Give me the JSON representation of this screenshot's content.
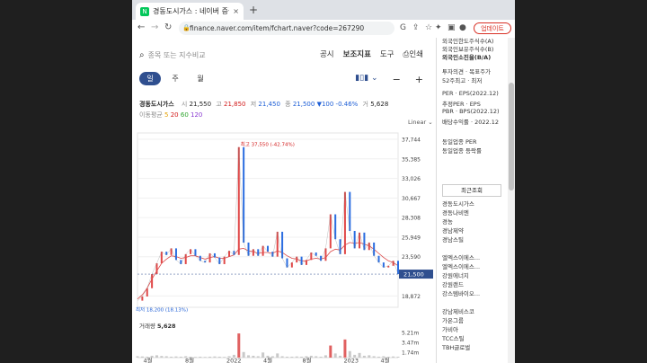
{
  "tab": {
    "title": "경동도시가스 : 네이버 증권",
    "close": "×",
    "new": "+",
    "favicon": "N"
  },
  "address": {
    "url": "finance.naver.com/item/fchart.naver?code=267290",
    "update_label": "업데이트"
  },
  "search": {
    "placeholder": "종목 또는 지수비교"
  },
  "menu": {
    "items": [
      "공시",
      "보조지표",
      "도구",
      "인쇄"
    ]
  },
  "periods": [
    "일",
    "주",
    "월"
  ],
  "stock": {
    "name": "경동도시가스",
    "open_label": "시",
    "open": "21,550",
    "high_label": "고",
    "high": "21,850",
    "low_label": "저",
    "low": "21,450",
    "close_label": "종",
    "close": "21,500",
    "change": "▼100",
    "change_pct": "-0.46%",
    "volume_label": "거",
    "volume": "5,628"
  },
  "ma": {
    "label": "이동평균",
    "values": [
      "5",
      "20",
      "60",
      "120"
    ],
    "colors": [
      "#e5a000",
      "#d21b1b",
      "#2fa52f",
      "#8a3ad1"
    ]
  },
  "scale_label": "Linear",
  "chart_data": {
    "type": "line",
    "price_ticks": [
      "37,744",
      "35,385",
      "33,026",
      "30,667",
      "28,308",
      "25,949",
      "23,590",
      "21,500",
      "18,872"
    ],
    "x_labels": [
      "4월",
      "8월",
      "2022",
      "4월",
      "8월",
      "2023",
      "4월"
    ],
    "max_label": "최고 37,550 (-42.74%)",
    "min_label": "최저 18,200 (18.13%)",
    "current_price": "21,500",
    "volume_title": "거래량",
    "volume_value": "5,628",
    "volume_ticks": [
      "5.21m",
      "3.47m",
      "1.74m"
    ],
    "prices": [
      18300,
      18800,
      19800,
      21500,
      22800,
      24200,
      23800,
      24600,
      23200,
      22700,
      23900,
      24500,
      23700,
      23100,
      22900,
      24000,
      23500,
      22700,
      23600,
      24300,
      23800,
      36800,
      25300,
      23700,
      24500,
      23700,
      24900,
      24200,
      23600,
      26600,
      23400,
      22300,
      22900,
      23600,
      22600,
      23200,
      24100,
      23700,
      23100,
      24600,
      28700,
      25700,
      23900,
      31400,
      26700,
      24600,
      26500,
      24400,
      25300,
      23700,
      22900,
      22300,
      22500,
      23100,
      21500
    ],
    "ma20": [
      18500,
      19000,
      19800,
      20900,
      21900,
      22800,
      23300,
      23700,
      23600,
      23400,
      23500,
      23700,
      23700,
      23500,
      23300,
      23500,
      23600,
      23400,
      23400,
      23600,
      23800,
      24500,
      24600,
      24300,
      24200,
      24000,
      24100,
      24100,
      24000,
      24300,
      24100,
      23700,
      23400,
      23300,
      23100,
      23100,
      23300,
      23400,
      23300,
      23500,
      24200,
      24500,
      24400,
      25000,
      25300,
      25200,
      25300,
      25100,
      24900,
      24500,
      24000,
      23500,
      23100,
      22900,
      22500
    ],
    "volumes": [
      0.3,
      0.25,
      0.2,
      0.4,
      0.5,
      0.35,
      0.3,
      0.2,
      0.25,
      0.2,
      0.3,
      0.2,
      0.15,
      0.2,
      0.15,
      0.2,
      0.25,
      0.2,
      0.15,
      0.3,
      0.6,
      5.2,
      1.2,
      0.5,
      0.4,
      0.3,
      1.1,
      0.4,
      0.3,
      0.9,
      0.3,
      0.2,
      0.2,
      0.25,
      0.2,
      0.3,
      0.4,
      0.3,
      0.2,
      0.5,
      2.6,
      0.9,
      0.4,
      3.9,
      1.4,
      0.6,
      1.0,
      0.4,
      0.5,
      0.3,
      0.2,
      0.3,
      0.2,
      0.25,
      0.2
    ],
    "ylim": [
      17500,
      38500
    ],
    "volume_max": 5.8
  },
  "right_panel": {
    "top": [
      "외국인한도주식수(A)",
      "외국인보유주식수(B)",
      "외국인소진율(B/A)"
    ],
    "opinion": [
      "투자의견 · 목표주가",
      "52주최고 · 최저"
    ],
    "per": [
      "PER · EPS(2022.12)",
      "추정PER · EPS",
      "PBR · BPS(2022.12)",
      "배당수익률 · 2022.12"
    ],
    "industry": [
      "동일업종 PER",
      "동일업종 등락률"
    ],
    "recent_header": "최근조회",
    "recent": [
      "경동도시가스",
      "경동나비엔",
      "경농",
      "경남제약",
      "경남스틸",
      "",
      "엘엑스이에스...",
      "엘엑스이에스...",
      "강원에너지",
      "강원랜드",
      "강스템바이오...",
      "",
      "강남제비스코",
      "가온그룹",
      "가비아",
      "TCC스틸",
      "TBH글로벌"
    ]
  }
}
